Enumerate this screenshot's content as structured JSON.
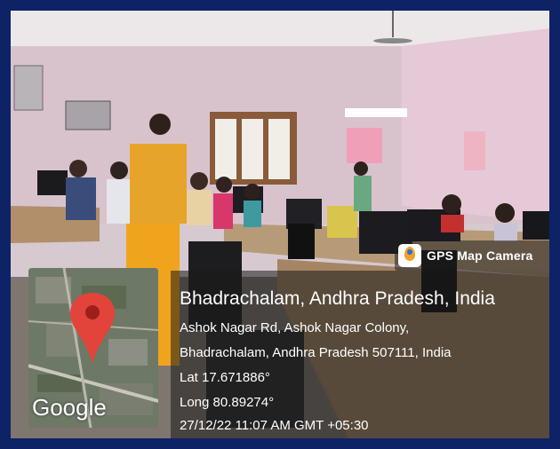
{
  "badge": {
    "label": "GPS Map Camera",
    "icon": "gps-map-camera-app-icon"
  },
  "location": {
    "title": "Bhadrachalam, Andhra Pradesh, India",
    "address_line1": "Ashok Nagar Rd, Ashok Nagar Colony,",
    "address_line2": "Bhadrachalam, Andhra Pradesh 507111, India",
    "latitude": "Lat 17.671886°",
    "longitude": "Long 80.89274°",
    "datetime": "27/12/22 11:07 AM GMT +05:30"
  },
  "map": {
    "logo": "Google",
    "pin_icon": "map-pin-icon",
    "pin_color": "#e2433a"
  },
  "colors": {
    "frame": "#0d2366",
    "wall": "#d9c7d0",
    "text": "#ffffff"
  }
}
